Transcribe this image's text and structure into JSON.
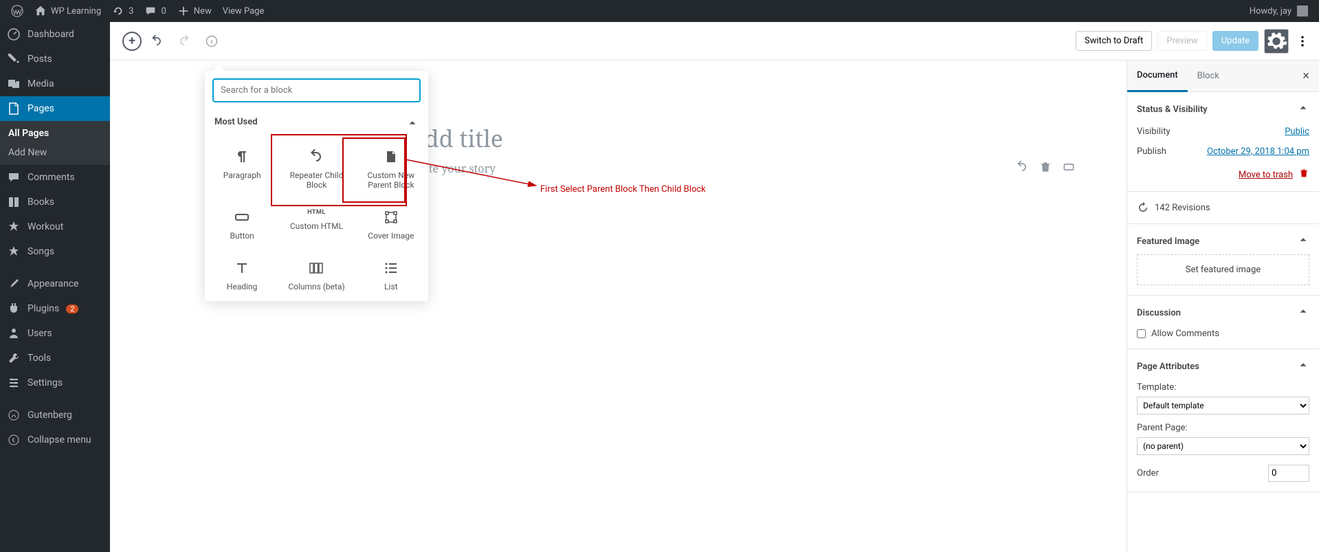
{
  "adminbar": {
    "site_title": "WP Learning",
    "updates_count": "3",
    "comments_count": "0",
    "new_label": "New",
    "view_page": "View Page",
    "howdy": "Howdy, jay"
  },
  "sidebar": {
    "items": [
      {
        "label": "Dashboard",
        "icon": "dashboard"
      },
      {
        "label": "Posts",
        "icon": "pin"
      },
      {
        "label": "Media",
        "icon": "media"
      },
      {
        "label": "Pages",
        "icon": "page"
      },
      {
        "label": "Comments",
        "icon": "comment"
      },
      {
        "label": "Books",
        "icon": "book"
      },
      {
        "label": "Workout",
        "icon": "star"
      },
      {
        "label": "Songs",
        "icon": "star"
      },
      {
        "label": "Appearance",
        "icon": "brush"
      },
      {
        "label": "Plugins",
        "icon": "plug",
        "badge": "2"
      },
      {
        "label": "Users",
        "icon": "user"
      },
      {
        "label": "Tools",
        "icon": "wrench"
      },
      {
        "label": "Settings",
        "icon": "sliders"
      },
      {
        "label": "Gutenberg",
        "icon": "gutenberg"
      },
      {
        "label": "Collapse menu",
        "icon": "collapse"
      }
    ],
    "submenu": {
      "all": "All Pages",
      "add": "Add New"
    }
  },
  "toolbar": {
    "switch_draft": "Switch to Draft",
    "preview": "Preview",
    "update": "Update"
  },
  "editor": {
    "title_placeholder": "Add title",
    "story_placeholder": "Write your story"
  },
  "inserter": {
    "search_placeholder": "Search for a block",
    "most_used": "Most Used",
    "blocks": [
      {
        "label": "Paragraph"
      },
      {
        "label": "Repeater Child Block"
      },
      {
        "label": "Custom New Parent Block"
      },
      {
        "label": "Button"
      },
      {
        "label": "Custom HTML"
      },
      {
        "label": "Cover Image"
      },
      {
        "label": "Heading"
      },
      {
        "label": "Columns (beta)"
      },
      {
        "label": "List"
      }
    ]
  },
  "annotation": {
    "text": "First Select Parent Block Then Child Block"
  },
  "rightpanel": {
    "tabs": {
      "document": "Document",
      "block": "Block"
    },
    "status": {
      "title": "Status & Visibility",
      "visibility": "Visibility",
      "visibility_val": "Public",
      "publish": "Publish",
      "publish_val": "October 29, 2018 1:04 pm",
      "trash": "Move to trash"
    },
    "revisions": {
      "count": "142 Revisions"
    },
    "featured": {
      "title": "Featured Image",
      "btn": "Set featured image"
    },
    "discussion": {
      "title": "Discussion",
      "allow": "Allow Comments"
    },
    "attrs": {
      "title": "Page Attributes",
      "template": "Template:",
      "template_val": "Default template",
      "parent": "Parent Page:",
      "parent_val": "(no parent)",
      "order": "Order",
      "order_val": "0"
    }
  }
}
